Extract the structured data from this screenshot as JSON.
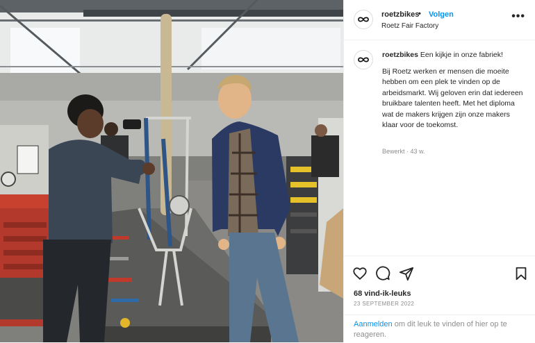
{
  "header": {
    "username": "roetzbikes",
    "separator": "•",
    "follow_label": "Volgen",
    "location": "Roetz Fair Factory",
    "more_label": "•••"
  },
  "caption": {
    "username": "roetzbikes",
    "intro": "Een kijkje in onze fabriek!",
    "body": "Bij Roetz werken er mensen die moeite hebben om een plek te vinden op de arbeidsmarkt. Wij geloven erin dat iedereen bruikbare talenten heeft. Met het diploma wat de makers krijgen zijn onze makers klaar voor de toekomst.",
    "meta": "Bewerkt · 43 w."
  },
  "stats": {
    "likes": "68 vind-ik-leuks",
    "date": "23 SEPTEMBER 2022"
  },
  "login": {
    "link": "Aanmelden",
    "text": " om dit leuk te vinden of hier op te reageren."
  },
  "icons": {
    "avatar": "roetz-logo-icon",
    "like": "heart-icon",
    "comment": "comment-icon",
    "share": "share-icon",
    "save": "bookmark-icon"
  },
  "colors": {
    "accent": "#0095f6",
    "text": "#262626",
    "muted": "#8e8e8e",
    "border": "#efefef"
  }
}
